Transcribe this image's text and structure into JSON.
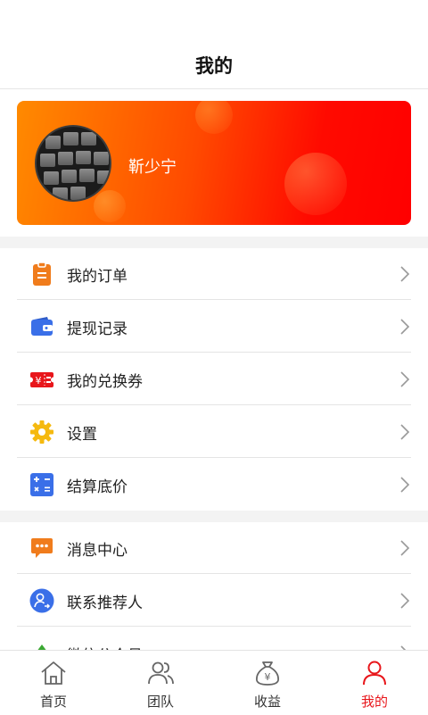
{
  "header": {
    "title": "我的"
  },
  "profile": {
    "name": "靳少宁"
  },
  "menu_group_1": [
    {
      "label": "我的订单",
      "icon": "clipboard-icon",
      "color": "#f07c1c"
    },
    {
      "label": "提现记录",
      "icon": "wallet-icon",
      "color": "#3a6fe8"
    },
    {
      "label": "我的兑换券",
      "icon": "coupon-icon",
      "color": "#e8161b"
    },
    {
      "label": "设置",
      "icon": "gear-icon",
      "color": "#f5b90f"
    },
    {
      "label": "结算底价",
      "icon": "calculator-icon",
      "color": "#3a6fe8"
    }
  ],
  "menu_group_2": [
    {
      "label": "消息中心",
      "icon": "chat-bubble-icon",
      "color": "#f07c1c"
    },
    {
      "label": "联系推荐人",
      "icon": "contact-referrer-icon",
      "color": "#3a6fe8"
    },
    {
      "label": "微信公众号",
      "icon": "wechat-account-icon",
      "color": "#3aa832"
    }
  ],
  "tabbar": [
    {
      "label": "首页",
      "icon": "home-icon"
    },
    {
      "label": "团队",
      "icon": "team-icon"
    },
    {
      "label": "收益",
      "icon": "money-bag-icon"
    },
    {
      "label": "我的",
      "icon": "user-icon",
      "active": true
    }
  ],
  "colors": {
    "accent": "#e8161b",
    "card_start": "#ff8a00",
    "card_end": "#ff0000"
  }
}
